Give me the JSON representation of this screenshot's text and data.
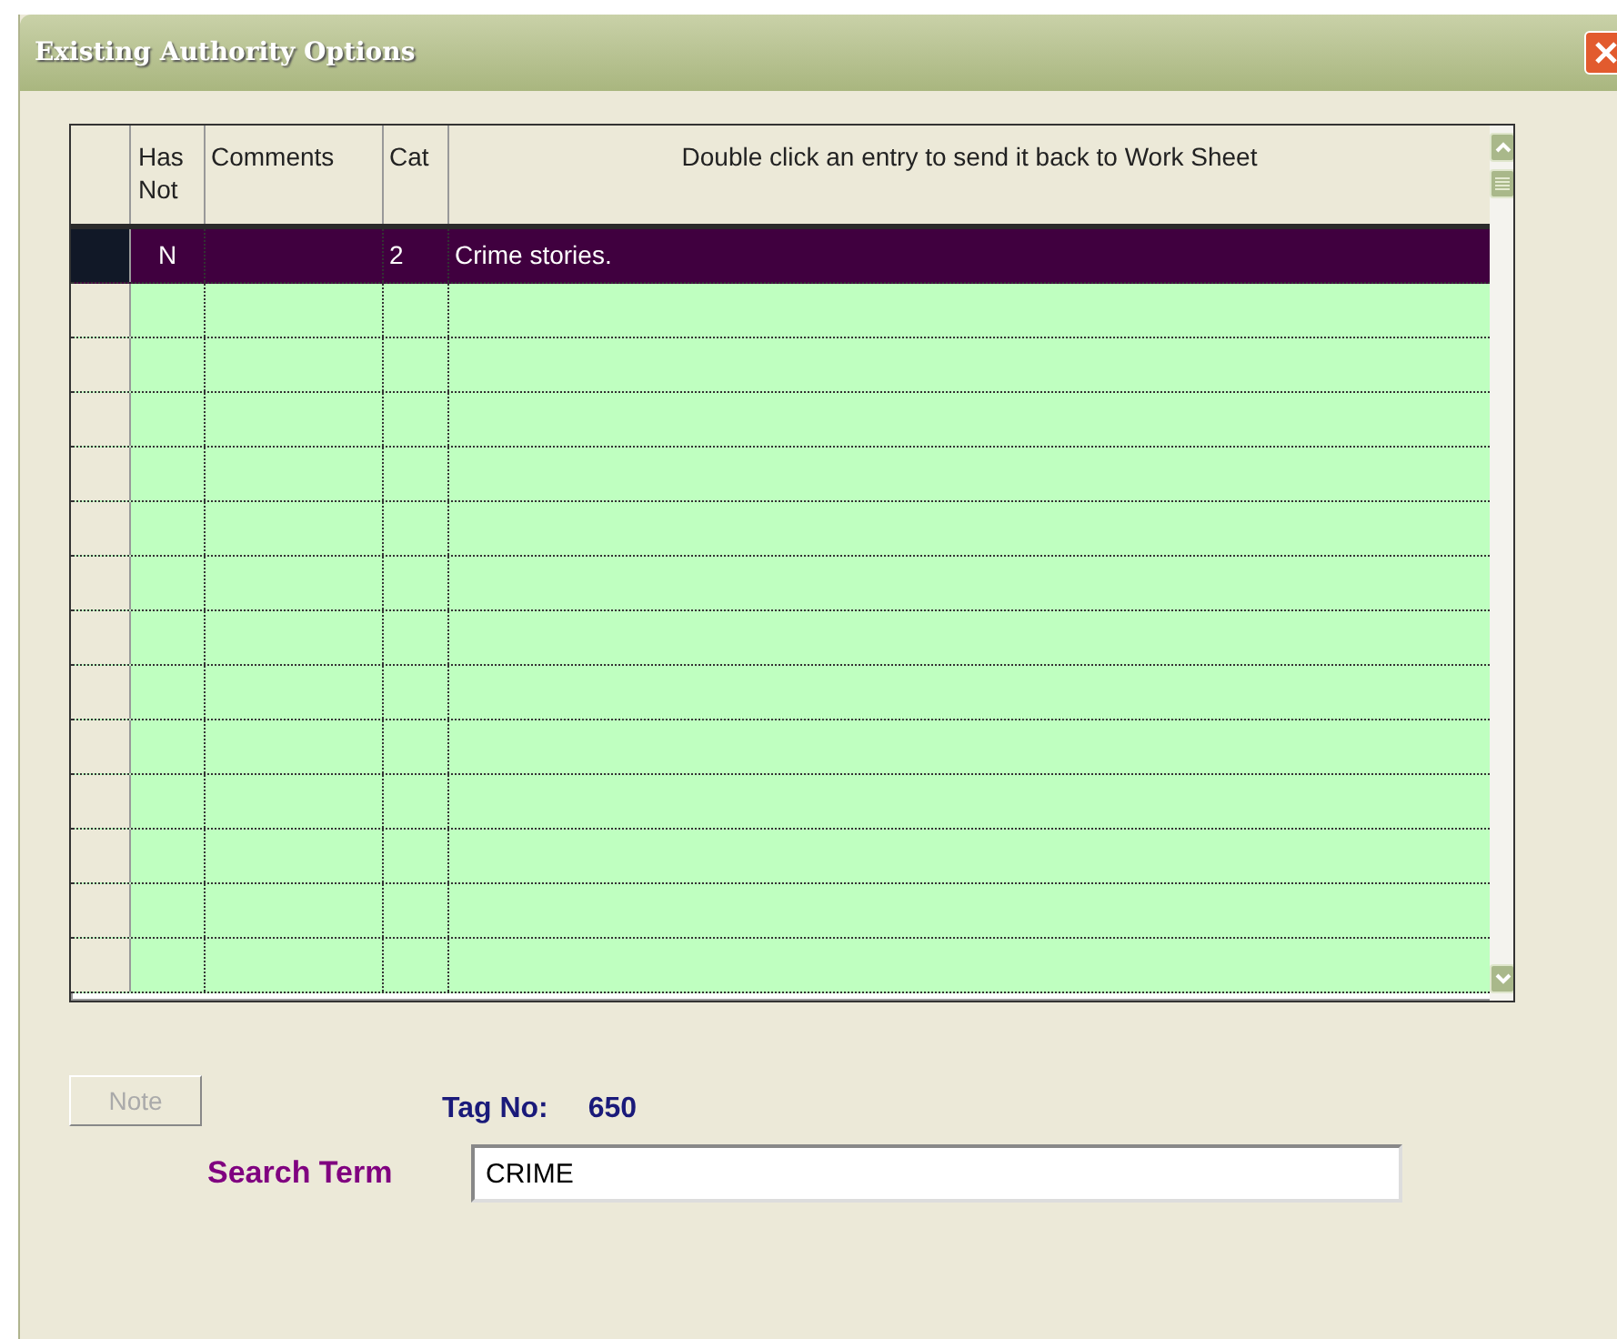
{
  "window": {
    "title": "Existing Authority Options"
  },
  "table": {
    "columns": [
      {
        "label": "Has Not"
      },
      {
        "label": "Comments"
      },
      {
        "label": "Cat"
      },
      {
        "label": "Double click an entry to send it back to Work Sheet"
      }
    ],
    "rows": [
      {
        "has_note": "N",
        "cat": "2",
        "description": "Crime stories.",
        "selected": true
      }
    ]
  },
  "note_button": {
    "label": "Note",
    "disabled": true
  },
  "tag": {
    "label": "Tag No:",
    "value": "650"
  },
  "search": {
    "label": "Search Term",
    "value": "CRIME"
  }
}
